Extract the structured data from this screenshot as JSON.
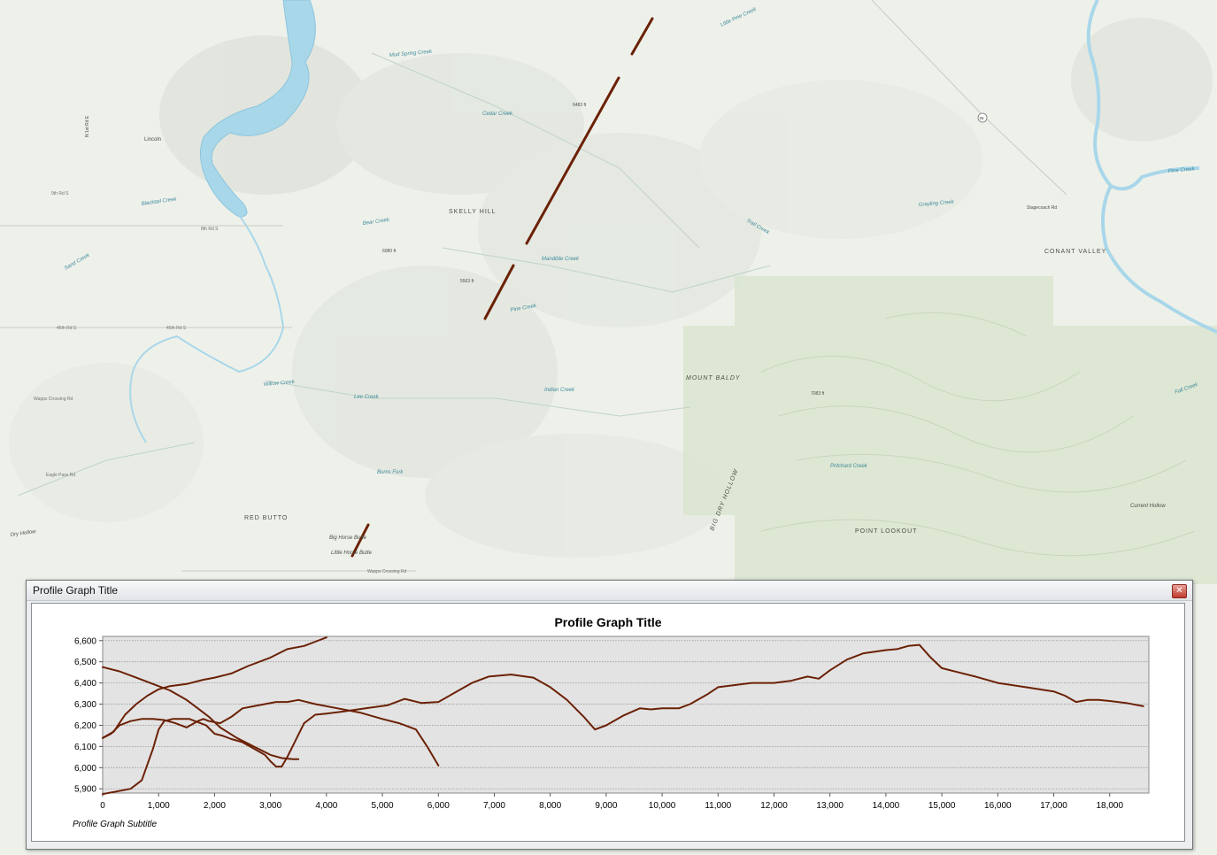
{
  "window": {
    "title": "Profile Graph Title",
    "close_icon": "close-icon"
  },
  "map": {
    "labels": {
      "skelly_hill": "SKELLY HILL",
      "mount_baldy": "MOUNT BALDY",
      "big_dry_hollow": "BIG DRY HOLLOW",
      "conant_valley": "CONANT VALLEY",
      "point_lookout": "POINT LOOKOUT",
      "red_butte": "RED BUTTO",
      "big_horse_butte": "Big Horse Butte",
      "little_horse_butte": "Little Horse Butte",
      "dry_hollow": "Dry Hollow",
      "sand_creek": "Sand Creek",
      "mud_spring_creek": "Mud Spring Creek",
      "little_pine_creek": "Little Pine Creek",
      "blacktail_creek": "Blacktail Creek",
      "willow_creek": "Willow Creek",
      "pine_creek": "Pine Creek",
      "bear_creek": "Bear Creek",
      "indian_creek": "Indian Creek",
      "cedar_creek": "Cedar Creek",
      "lee_creek": "Lee Creek",
      "eagle_pass_rd": "Eagle Pass Rd",
      "road_45th_s": "45th Rd S",
      "road_45th_s_2": "45th Rd S",
      "road_9th_s": "9th Rd S",
      "road_8th_s": "8th Rd S",
      "wapps_crossing_rd": "Wapps Crossing Rd",
      "wapps_crossing_rd_2": "Wapps Crossing Rd",
      "grayling_creek": "Grayling Creek",
      "pine_creek_east": "Pine Creek",
      "stagecoach_rd": "Stagecoach Rd",
      "burns_fork": "Burns Fork",
      "pritchard_creek": "Pritchard Creek",
      "hollow_east": "Current Hollow",
      "trail_creek": "Trail Creek",
      "mandible_creek": "Mandible Creek",
      "fall_creek": "Fall Creek",
      "elev_1": "6483 ft",
      "elev_2": "7083 ft",
      "elev_3": "5563 ft",
      "elev_4": "6080 ft",
      "lincoln": "Lincoln",
      "n_1st": "N 1st Rd E",
      "shield": "26"
    },
    "colors": {
      "background": "#eef1ea",
      "forest": "#dce7d3",
      "water": "#a9d7ea",
      "profile_line": "#6b2106"
    }
  },
  "chart_data": {
    "type": "line",
    "title": "Profile Graph Title",
    "subtitle": "Profile Graph Subtitle",
    "xlabel": "",
    "ylabel": "",
    "xlim": [
      0,
      18700
    ],
    "ylim": [
      5880,
      6620
    ],
    "xticks": [
      0,
      1000,
      2000,
      3000,
      4000,
      5000,
      6000,
      7000,
      8000,
      9000,
      10000,
      11000,
      12000,
      13000,
      14000,
      15000,
      16000,
      17000,
      18000
    ],
    "yticks": [
      5900,
      6000,
      6100,
      6200,
      6300,
      6400,
      6500,
      6600
    ],
    "xtick_labels": [
      "0",
      "1,000",
      "2,000",
      "3,000",
      "4,000",
      "5,000",
      "6,000",
      "7,000",
      "8,000",
      "9,000",
      "10,000",
      "11,000",
      "12,000",
      "13,000",
      "14,000",
      "15,000",
      "16,000",
      "17,000",
      "18,000"
    ],
    "ytick_labels": [
      "5,900",
      "6,000",
      "6,100",
      "6,200",
      "6,300",
      "6,400",
      "6,500",
      "6,600"
    ],
    "grid": true,
    "background": "#e3e3e3",
    "line_color": "#6b2106",
    "series": [
      {
        "x": [
          0,
          200,
          400,
          600,
          800,
          1000,
          1200,
          1500,
          1800,
          2000,
          2300,
          2600,
          3000,
          3300,
          3600,
          3800,
          4000
        ],
        "y": [
          6140,
          6170,
          6250,
          6300,
          6340,
          6370,
          6385,
          6395,
          6415,
          6425,
          6445,
          6480,
          6520,
          6560,
          6575,
          6595,
          6615
        ]
      },
      {
        "x": [
          0,
          300,
          600,
          900,
          1200,
          1500,
          1700,
          1900,
          2100,
          2400,
          2700,
          3000,
          3200,
          3400,
          3500
        ],
        "y": [
          6475,
          6455,
          6425,
          6395,
          6365,
          6320,
          6280,
          6240,
          6190,
          6140,
          6100,
          6060,
          6045,
          6040,
          6040
        ]
      },
      {
        "x": [
          0,
          150,
          300,
          500,
          700,
          900,
          1100,
          1300,
          1500,
          1700,
          1800,
          1900,
          2100,
          2300,
          2500,
          2700,
          2900,
          3100,
          3300,
          3500,
          3800,
          4200,
          4600,
          5000,
          5300,
          5600,
          5800,
          6000
        ],
        "y": [
          6140,
          6160,
          6200,
          6220,
          6230,
          6230,
          6225,
          6210,
          6190,
          6220,
          6230,
          6220,
          6210,
          6240,
          6280,
          6290,
          6300,
          6310,
          6310,
          6320,
          6300,
          6280,
          6260,
          6230,
          6210,
          6180,
          6100,
          6010
        ]
      },
      {
        "x": [
          0,
          200,
          500,
          700,
          900,
          1000,
          1100,
          1250,
          1400,
          1550,
          1700,
          1850,
          2000,
          2150,
          2300,
          2500,
          2700,
          2900,
          3000,
          3100,
          3200,
          3300,
          3450,
          3600,
          3800,
          4000,
          4300,
          4700,
          5100,
          5400,
          5700,
          6000,
          6300,
          6600,
          6900,
          7300,
          7700,
          8000,
          8300,
          8600,
          8800,
          9000,
          9300,
          9600,
          9800,
          10000,
          10300,
          10500,
          10800,
          11000,
          11300,
          11600,
          12000,
          12300,
          12600,
          12800,
          13000,
          13300,
          13600,
          14000,
          14200,
          14400,
          14600,
          14800,
          15000,
          15300,
          15600,
          16000,
          16500,
          17000,
          17200,
          17400,
          17600,
          17800,
          18000,
          18300,
          18600
        ],
        "y": [
          5875,
          5885,
          5900,
          5940,
          6090,
          6180,
          6220,
          6230,
          6230,
          6230,
          6215,
          6200,
          6160,
          6150,
          6135,
          6120,
          6090,
          6060,
          6030,
          6005,
          6005,
          6050,
          6130,
          6210,
          6250,
          6255,
          6265,
          6280,
          6295,
          6325,
          6305,
          6310,
          6355,
          6400,
          6430,
          6440,
          6425,
          6380,
          6320,
          6240,
          6180,
          6200,
          6245,
          6280,
          6275,
          6280,
          6280,
          6300,
          6345,
          6380,
          6390,
          6400,
          6400,
          6410,
          6430,
          6420,
          6460,
          6510,
          6540,
          6555,
          6560,
          6575,
          6580,
          6520,
          6470,
          6450,
          6430,
          6400,
          6380,
          6360,
          6340,
          6310,
          6320,
          6320,
          6315,
          6305,
          6290
        ]
      }
    ]
  }
}
